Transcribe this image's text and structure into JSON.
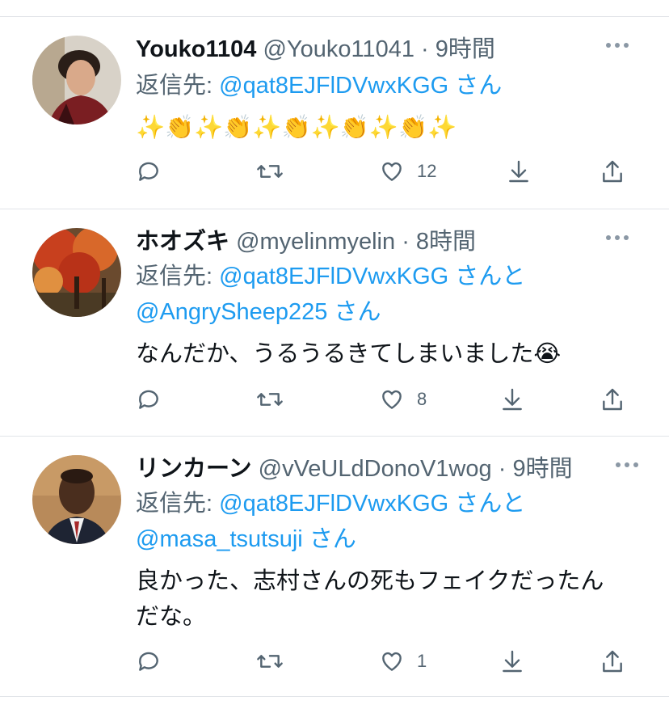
{
  "tweets": [
    {
      "name": "Youko1104",
      "handle": "@Youko11041",
      "dot": "·",
      "time": "9時間",
      "reply_prefix": "返信先: ",
      "mention1": "@qat8EJFlDVwxKGG",
      "mention1_suffix": "さん",
      "mention2": "",
      "mention2_suffix": "",
      "text": "✨👏✨👏✨👏✨👏✨👏✨",
      "text_line2": "",
      "like_count": "12",
      "avatar_icon": "avatar-man-photo"
    },
    {
      "name": "ホオズキ",
      "handle": "@myelinmyelin",
      "dot": "·",
      "time": "8時間",
      "reply_prefix": "返信先: ",
      "mention1": "@qat8EJFlDVwxKGG",
      "mention1_suffix": "さんと",
      "mention2": "@AngrySheep225",
      "mention2_suffix": "さん",
      "text": "なんだか、うるうるきてしまいました😭",
      "text_line2": "",
      "like_count": "8",
      "avatar_icon": "avatar-autumn-tree-photo"
    },
    {
      "name": "リンカーン",
      "handle": "@vVeULdDonoV1wog",
      "dot": "·",
      "time": "9時間",
      "reply_prefix": "返信先: ",
      "mention1": "@qat8EJFlDVwxKGG",
      "mention1_suffix": "さんと",
      "mention2": "@masa_tsutsuji",
      "mention2_suffix": "さん",
      "text": "良かった、志村さんの死もフェイクだったん",
      "text_line2": "だな。",
      "like_count": "1",
      "avatar_icon": "avatar-man-suit-photo"
    }
  ],
  "icons": {
    "reply": "reply-icon",
    "retweet": "retweet-icon",
    "like": "heart-icon",
    "download": "download-icon",
    "share": "share-icon",
    "more": "more-icon"
  },
  "colors": {
    "mention": "#1d9bf0",
    "secondary_text": "#536471",
    "divider": "#e1e4e8"
  }
}
